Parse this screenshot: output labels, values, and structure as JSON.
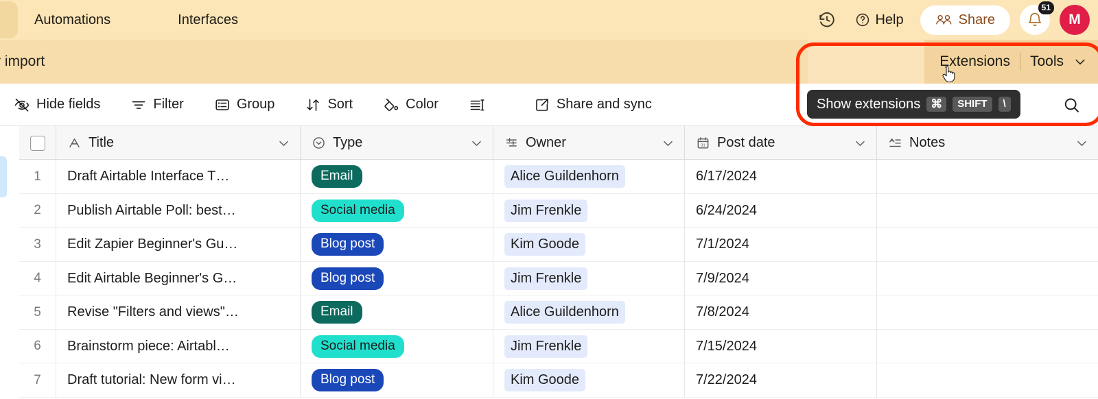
{
  "topbar": {
    "nav": [
      {
        "label": "Automations",
        "name": "nav-automations"
      },
      {
        "label": "Interfaces",
        "name": "nav-interfaces"
      }
    ],
    "history_icon": "history-clock-icon",
    "help_label": "Help",
    "share_label": "Share",
    "notification_count": "51",
    "avatar_initial": "M",
    "avatar_color": "#e01e48",
    "background_color": "#fce5b6"
  },
  "secondbar": {
    "left_text": "r import",
    "extensions_label": "Extensions",
    "tools_label": "Tools",
    "background_color": "#f7dcac"
  },
  "toolbar": {
    "items": [
      {
        "label": "Hide fields",
        "icon": "eye-slash-icon"
      },
      {
        "label": "Filter",
        "icon": "filter-icon"
      },
      {
        "label": "Group",
        "icon": "group-icon"
      },
      {
        "label": "Sort",
        "icon": "sort-arrows-icon"
      },
      {
        "label": "Color",
        "icon": "paint-bucket-icon"
      },
      {
        "label": "",
        "icon": "row-height-icon"
      },
      {
        "label": "Share and sync",
        "icon": "external-link-icon"
      }
    ],
    "search_icon": "search-icon"
  },
  "tooltip": {
    "text": "Show extensions",
    "keys": [
      "⌘",
      "SHIFT",
      "\\"
    ],
    "background_color": "#2f2f2f"
  },
  "highlight": {
    "color": "#ff2b00"
  },
  "table": {
    "columns": [
      {
        "label": "Title",
        "icon": "text-field-icon"
      },
      {
        "label": "Type",
        "icon": "single-select-icon"
      },
      {
        "label": "Owner",
        "icon": "collaborator-icon"
      },
      {
        "label": "Post date",
        "icon": "calendar-icon"
      },
      {
        "label": "Notes",
        "icon": "long-text-icon"
      }
    ],
    "rows": [
      {
        "num": "1",
        "title": "Draft Airtable Interface T…",
        "type": "Email",
        "type_class": "tag-email",
        "owner": "Alice Guildenhorn",
        "date": "6/17/2024",
        "notes": ""
      },
      {
        "num": "2",
        "title": "Publish Airtable Poll: best…",
        "type": "Social media",
        "type_class": "tag-social",
        "owner": "Jim Frenkle",
        "date": "6/24/2024",
        "notes": ""
      },
      {
        "num": "3",
        "title": "Edit Zapier Beginner's Gu…",
        "type": "Blog post",
        "type_class": "tag-blog",
        "owner": "Kim Goode",
        "date": "7/1/2024",
        "notes": ""
      },
      {
        "num": "4",
        "title": "Edit Airtable Beginner's G…",
        "type": "Blog post",
        "type_class": "tag-blog",
        "owner": "Jim Frenkle",
        "date": "7/9/2024",
        "notes": ""
      },
      {
        "num": "5",
        "title": "Revise \"Filters and views\"…",
        "type": "Email",
        "type_class": "tag-email",
        "owner": "Alice Guildenhorn",
        "date": "7/8/2024",
        "notes": ""
      },
      {
        "num": "6",
        "title": "Brainstorm piece: Airtabl…",
        "type": "Social media",
        "type_class": "tag-social",
        "owner": "Jim Frenkle",
        "date": "7/15/2024",
        "notes": ""
      },
      {
        "num": "7",
        "title": "Draft tutorial: New form vi…",
        "type": "Blog post",
        "type_class": "tag-blog",
        "owner": "Kim Goode",
        "date": "7/22/2024",
        "notes": ""
      }
    ]
  }
}
